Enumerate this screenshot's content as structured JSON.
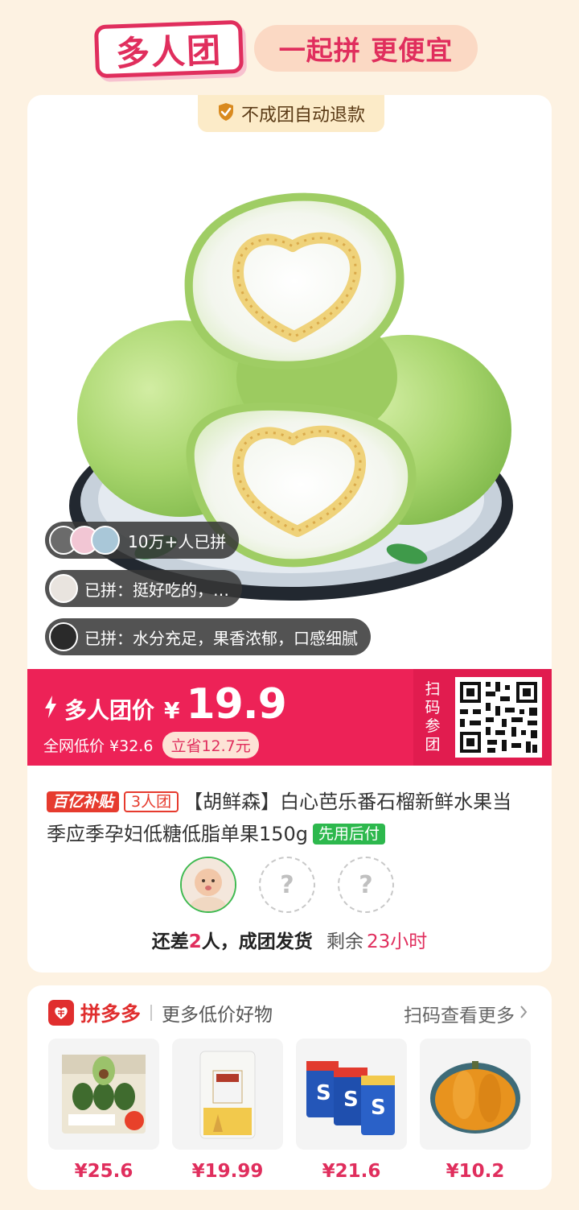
{
  "header": {
    "logo_text": "多人团",
    "slogan": "一起拼 更便宜"
  },
  "product": {
    "refund_badge": "不成团自动退款",
    "image_icon": "guava-fruit-image",
    "bubbles": [
      "10万+人已拼",
      "已拼：挺好吃的，…",
      "已拼：水分充足，果香浓郁，口感细腻"
    ],
    "price_label": "多人团价",
    "currency": "¥",
    "price": "19.9",
    "original_price": "全网低价 ¥32.6",
    "save": "立省12.7元",
    "scan_text": "扫码参团",
    "tag_subsidy": "百亿补贴",
    "tag_group": "3人团",
    "title": "【胡鲜森】白心芭乐番石榴新鲜水果当季应季孕妇低糖低脂单果150g",
    "tag_pay": "先用后付",
    "empty_slot": "?",
    "status_prefix": "还差",
    "status_count": "2",
    "status_suffix": "人，成团发货",
    "remaining_label": "剩余",
    "remaining_time": "23小时"
  },
  "recommend": {
    "brand": "拼多多",
    "title": "更多低价好物",
    "more": "扫码查看更多",
    "items": [
      {
        "icon": "avocado-box-image",
        "price": "¥25.6"
      },
      {
        "icon": "flour-bag-image",
        "price": "¥19.99"
      },
      {
        "icon": "chewing-gum-image",
        "price": "¥21.6"
      },
      {
        "icon": "pumpkin-image",
        "price": "¥10.2"
      }
    ]
  },
  "colors": {
    "brand_red": "#E02E5D",
    "price_bar": "#ED2257",
    "background": "#FDF2E2",
    "guava_green": "#A6D46C"
  }
}
